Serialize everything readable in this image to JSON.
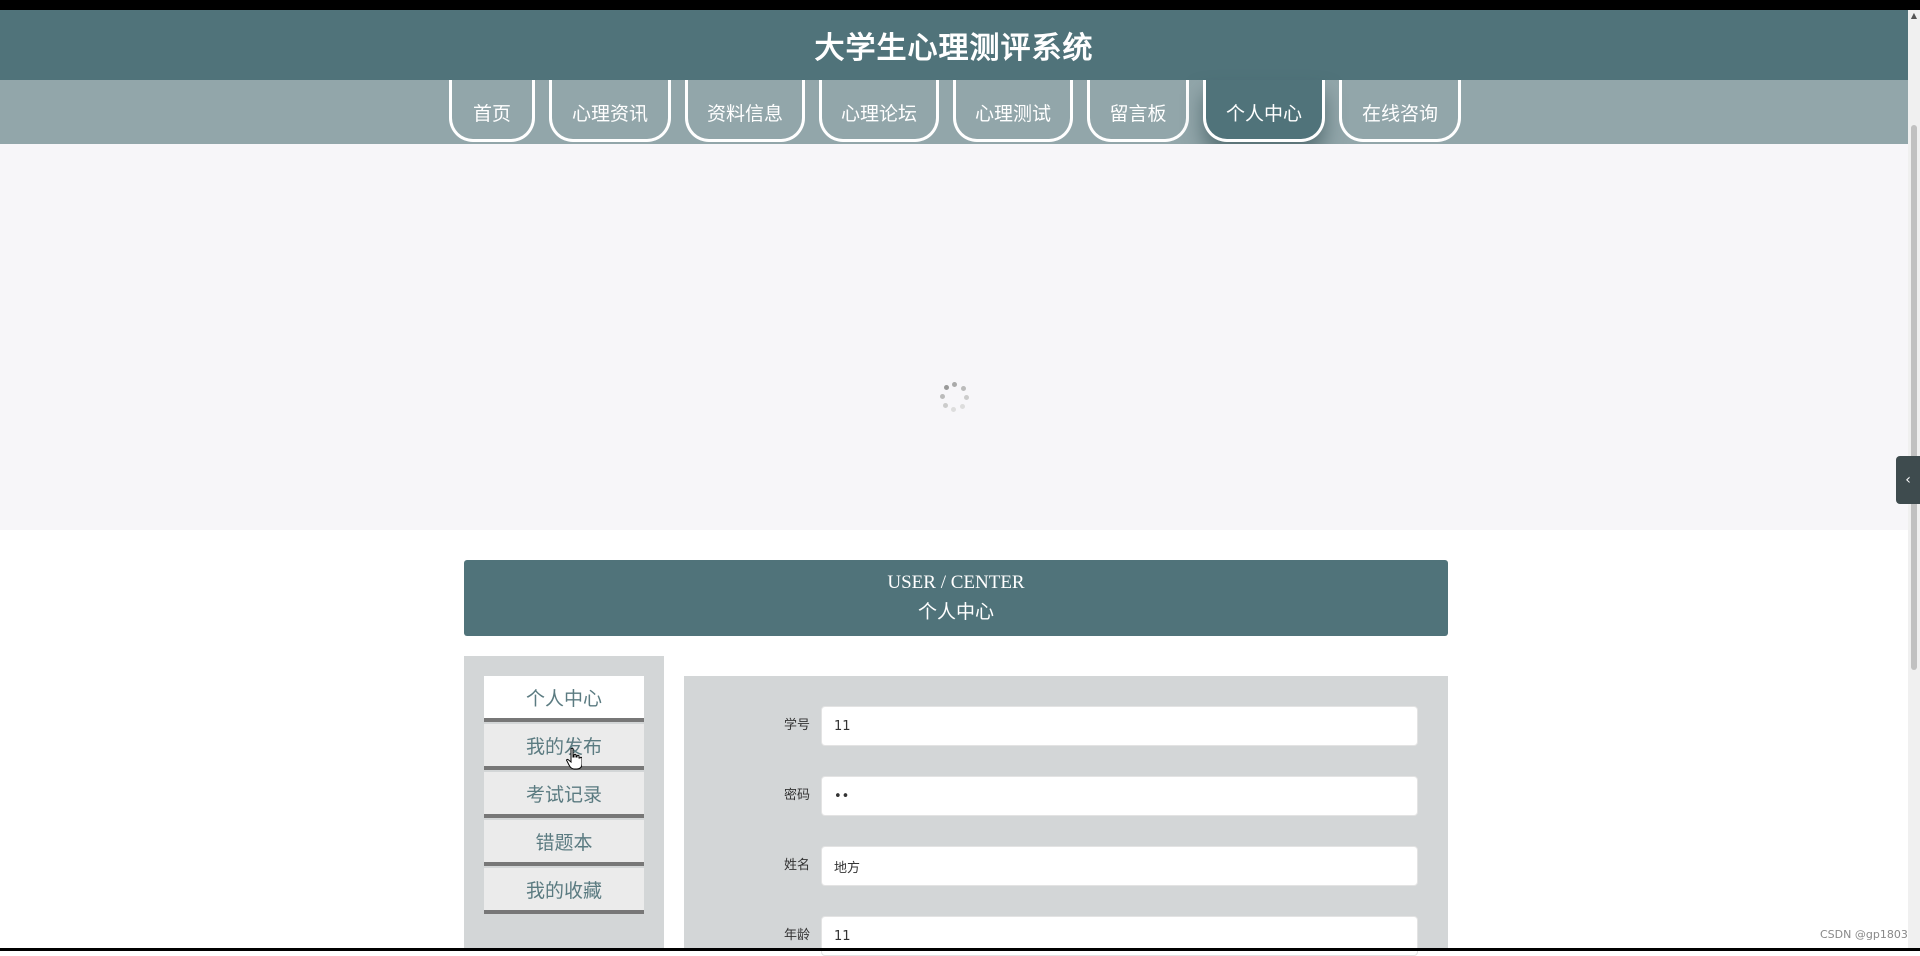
{
  "site": {
    "title": "大学生心理测评系统"
  },
  "nav": {
    "items": [
      {
        "label": "首页"
      },
      {
        "label": "心理资讯"
      },
      {
        "label": "资料信息"
      },
      {
        "label": "心理论坛"
      },
      {
        "label": "心理测试"
      },
      {
        "label": "留言板"
      },
      {
        "label": "个人中心",
        "active": true
      },
      {
        "label": "在线咨询"
      }
    ]
  },
  "section": {
    "title_en": "USER / CENTER",
    "title_zh": "个人中心"
  },
  "sidebar": {
    "items": [
      {
        "label": "个人中心",
        "active": true
      },
      {
        "label": "我的发布"
      },
      {
        "label": "考试记录"
      },
      {
        "label": "错题本"
      },
      {
        "label": "我的收藏"
      }
    ]
  },
  "form": {
    "fields": [
      {
        "label": "学号",
        "value": "11"
      },
      {
        "label": "密码",
        "value": "••"
      },
      {
        "label": "姓名",
        "value": "地方"
      },
      {
        "label": "年龄",
        "value": "11"
      }
    ]
  },
  "watermark": "CSDN @gp1803",
  "colors": {
    "primary": "#50737a",
    "nav_bg": "#92a6aa",
    "panel_bg": "#d3d6d7"
  }
}
